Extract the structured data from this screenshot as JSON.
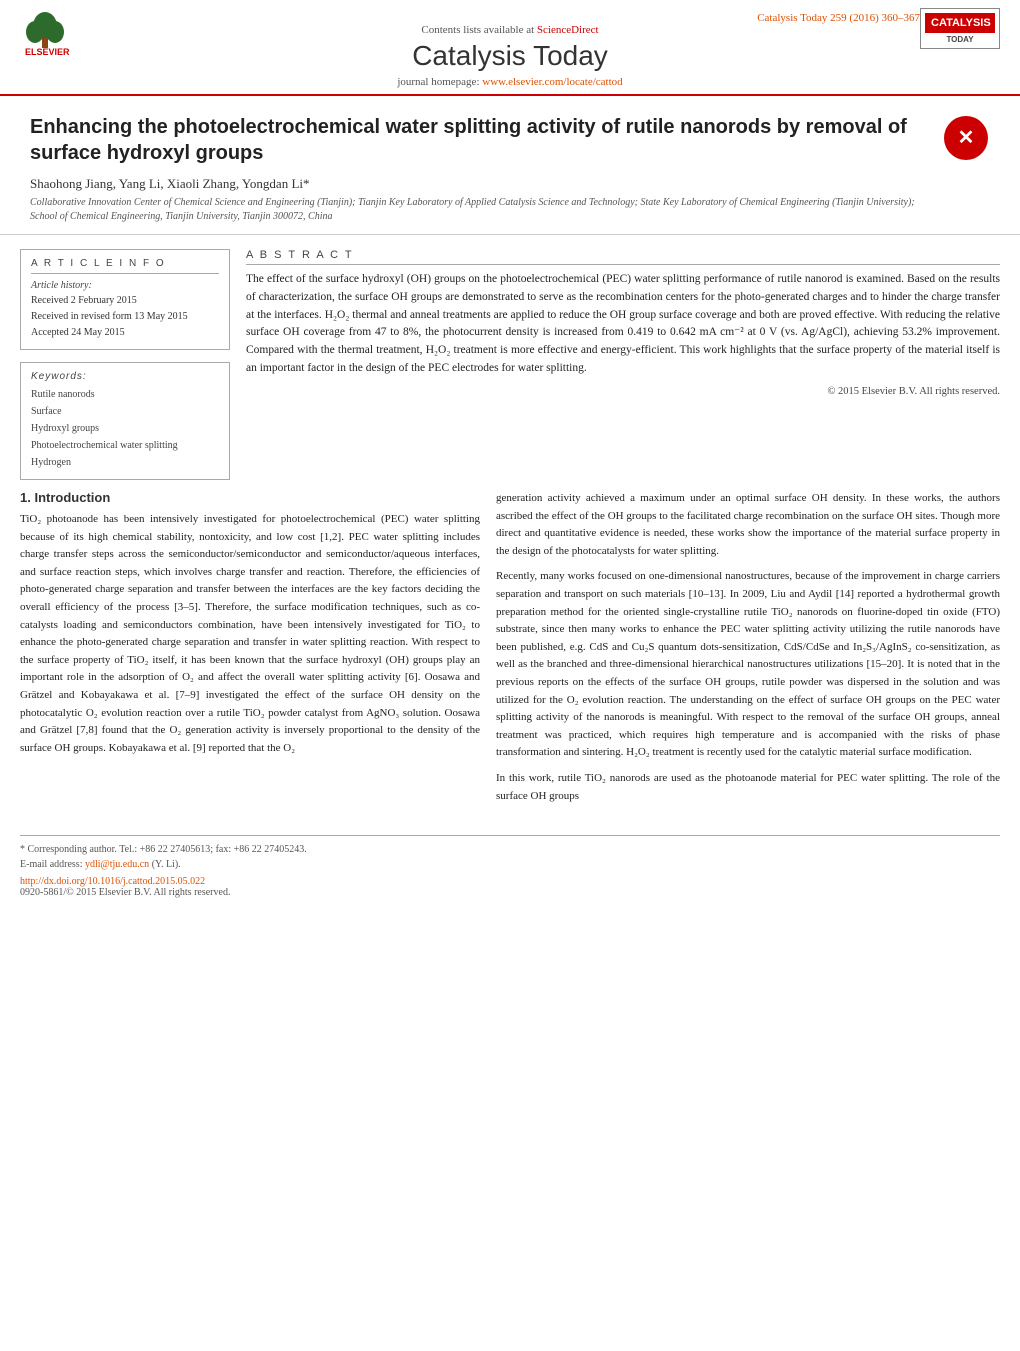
{
  "header": {
    "citation": "Catalysis Today 259 (2016) 360–367",
    "sciencedirect_text": "Contents lists available at",
    "sciencedirect_link": "ScienceDirect",
    "journal_title": "Catalysis Today",
    "homepage_text": "journal homepage:",
    "homepage_link": "www.elsevier.com/locate/cattod",
    "elsevier_logo_alt": "ELSEVIER",
    "catalysis_logo_alt": "CATALYSIS"
  },
  "article": {
    "title": "Enhancing the photoelectrochemical water splitting activity of rutile nanorods by removal of surface hydroxyl groups",
    "authors": "Shaohong Jiang, Yang Li, Xiaoli Zhang, Yongdan Li*",
    "affiliation": "Collaborative Innovation Center of Chemical Science and Engineering (Tianjin); Tianjin Key Laboratory of Applied Catalysis Science and Technology; State Key Laboratory of Chemical Engineering (Tianjin University); School of Chemical Engineering, Tianjin University, Tianjin 300072, China",
    "article_info_title": "A R T I C L E   I N F O",
    "article_history_label": "Article history:",
    "received_text": "Received 2 February 2015",
    "revised_text": "Received in revised form 13 May 2015",
    "accepted_text": "Accepted 24 May 2015",
    "keywords_label": "Keywords:",
    "keywords": [
      "Rutile nanorods",
      "Surface",
      "Hydroxyl groups",
      "Photoelectrochemical water splitting",
      "Hydrogen"
    ],
    "abstract_title": "A B S T R A C T",
    "abstract_text": "The effect of the surface hydroxyl (OH) groups on the photoelectrochemical (PEC) water splitting performance of rutile nanorod is examined. Based on the results of characterization, the surface OH groups are demonstrated to serve as the recombination centers for the photo-generated charges and to hinder the charge transfer at the interfaces. H₂O₂ thermal and anneal treatments are applied to reduce the OH group surface coverage and both are proved effective. With reducing the relative surface OH coverage from 47 to 8%, the photocurrent density is increased from 0.419 to 0.642 mA cm⁻² at 0 V (vs. Ag/AgCl), achieving 53.2% improvement. Compared with the thermal treatment, H₂O₂ treatment is more effective and energy-efficient. This work highlights that the surface property of the material itself is an important factor in the design of the PEC electrodes for water splitting.",
    "copyright": "© 2015 Elsevier B.V. All rights reserved."
  },
  "intro": {
    "section_number": "1.",
    "section_title": "Introduction",
    "paragraph1": "TiO₂ photoanode has been intensively investigated for photoelectrochemical (PEC) water splitting because of its high chemical stability, nontoxicity, and low cost [1,2]. PEC water splitting includes charge transfer steps across the semiconductor/semiconductor and semiconductor/aqueous interfaces, and surface reaction steps, which involves charge transfer and reaction. Therefore, the efficiencies of photo-generated charge separation and transfer between the interfaces are the key factors deciding the overall efficiency of the process [3–5]. Therefore, the surface modification techniques, such as co-catalysts loading and semiconductors combination, have been intensively investigated for TiO₂ to enhance the photo-generated charge separation and transfer in water splitting reaction. With respect to the surface property of TiO₂ itself, it has been known that the surface hydroxyl (OH) groups play an important role in the adsorption of O₂ and affect the overall water splitting activity [6]. Oosawa and Grätzel and Kobayakawa et al. [7–9] investigated the effect of the surface OH density on the photocatalytic O₂ evolution reaction over a rutile TiO₂ powder catalyst from AgNO₃ solution. Oosawa and Grätzel [7,8] found that the O₂ generation activity is inversely proportional to the density of the surface OH groups. Kobayakawa et al. [9] reported that the O₂",
    "right_paragraph1": "generation activity achieved a maximum under an optimal surface OH density. In these works, the authors ascribed the effect of the OH groups to the facilitated charge recombination on the surface OH sites. Though more direct and quantitative evidence is needed, these works show the importance of the material surface property in the design of the photocatalysts for water splitting.",
    "right_paragraph2": "Recently, many works focused on one-dimensional nanostructures, because of the improvement in charge carriers separation and transport on such materials [10–13]. In 2009, Liu and Aydil [14] reported a hydrothermal growth preparation method for the oriented single-crystalline rutile TiO₂ nanorods on fluorine-doped tin oxide (FTO) substrate, since then many works to enhance the PEC water splitting activity utilizing the rutile nanorods have been published, e.g. CdS and Cu₂S quantum dots-sensitization, CdS/CdSe and In₂S₃/AgInS₂ co-sensitization, as well as the branched and three-dimensional hierarchical nanostructures utilizations [15–20]. It is noted that in the previous reports on the effects of the surface OH groups, rutile powder was dispersed in the solution and was utilized for the O₂ evolution reaction. The understanding on the effect of surface OH groups on the PEC water splitting activity of the nanorods is meaningful. With respect to the removal of the surface OH groups, anneal treatment was practiced, which requires high temperature and is accompanied with the risks of phase transformation and sintering. H₂O₂ treatment is recently used for the catalytic material surface modification.",
    "right_paragraph3": "In this work, rutile TiO₂ nanorods are used as the photoanode material for PEC water splitting. The role of the surface OH groups"
  },
  "footer": {
    "corresponding_note": "* Corresponding author. Tel.: +86 22 27405613; fax: +86 22 27405243.",
    "email_label": "E-mail address:",
    "email": "ydli@tju.edu.cn",
    "email_suffix": " (Y. Li).",
    "doi_text": "http://dx.doi.org/10.1016/j.cattod.2015.05.022",
    "issn_text": "0920-5861/© 2015 Elsevier B.V. All rights reserved."
  }
}
